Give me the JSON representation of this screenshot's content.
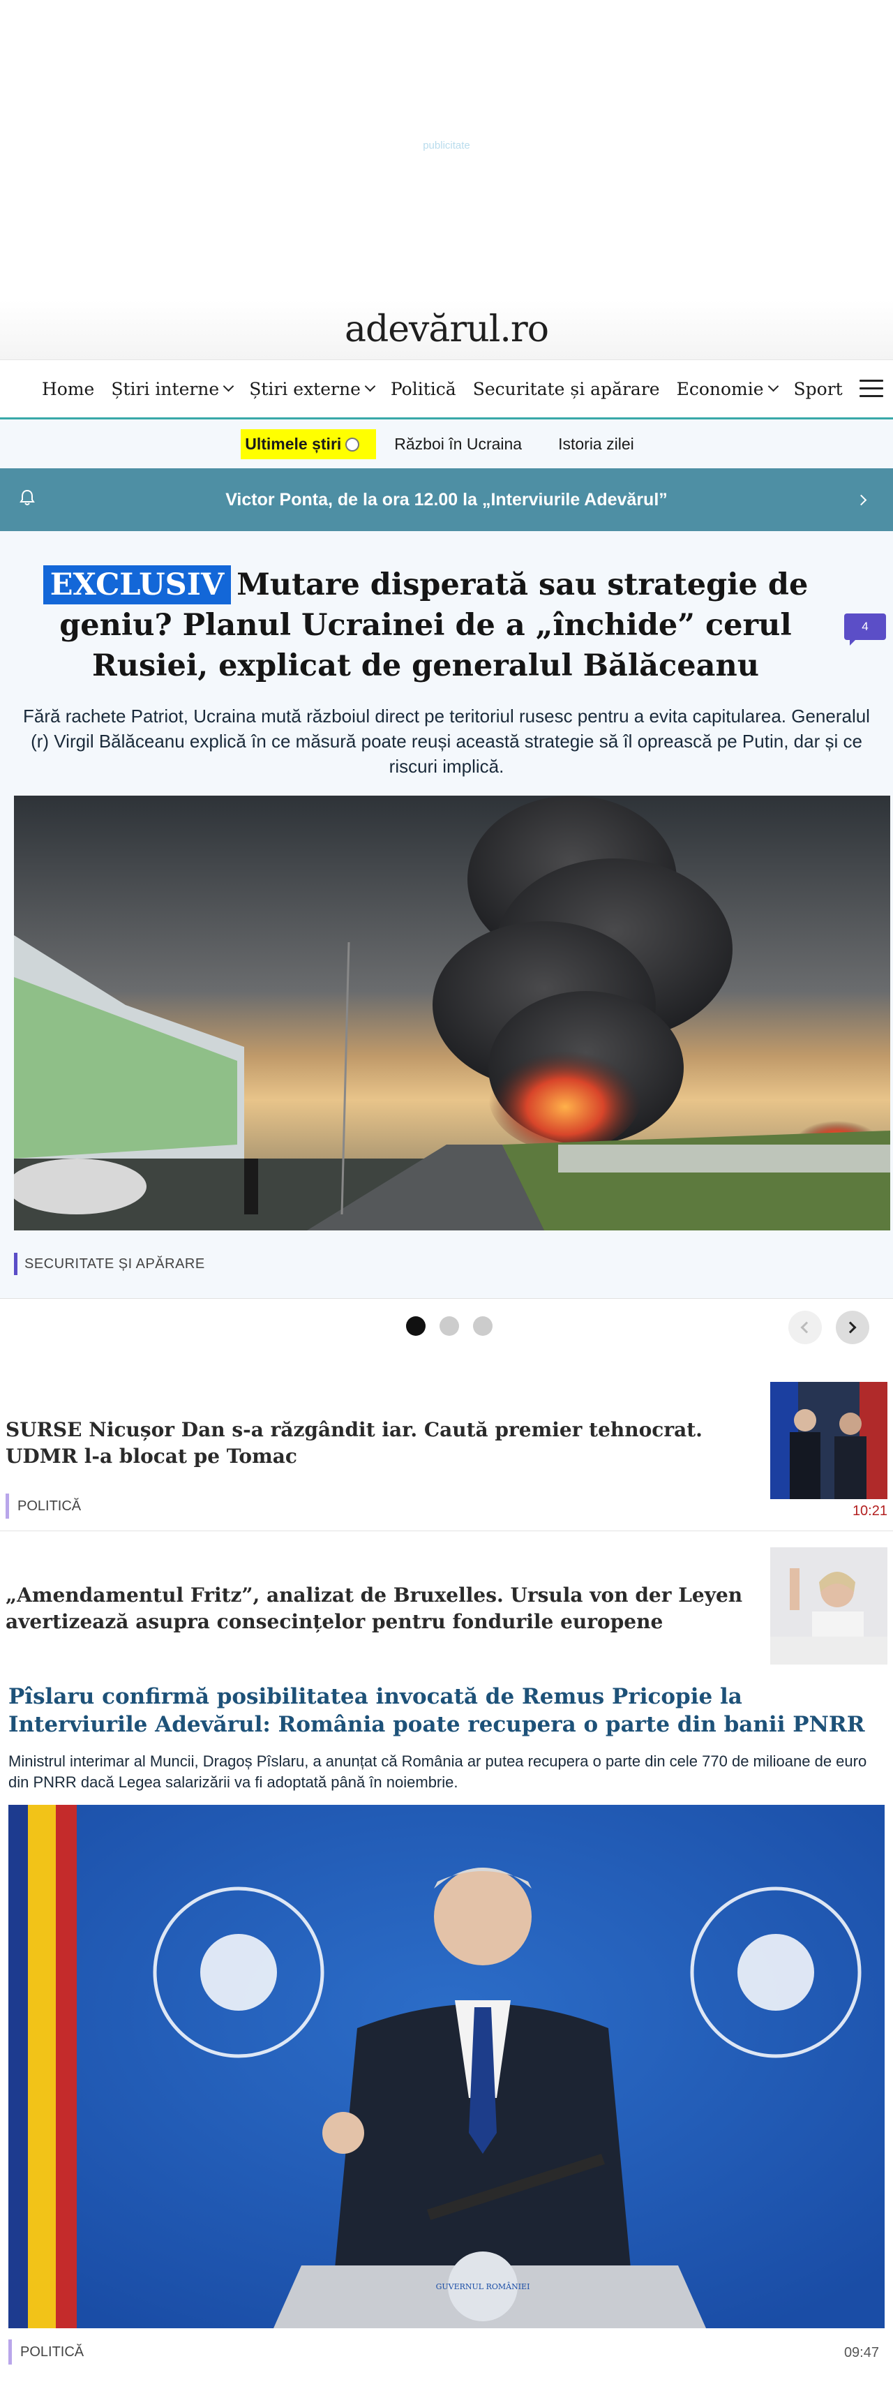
{
  "ad": {
    "label": "publicitate"
  },
  "site": {
    "logo": "adevărul.ro"
  },
  "nav": {
    "items": [
      {
        "label": "Home",
        "dropdown": false
      },
      {
        "label": "Știri interne",
        "dropdown": true
      },
      {
        "label": "Știri externe",
        "dropdown": true
      },
      {
        "label": "Politică",
        "dropdown": false
      },
      {
        "label": "Securitate și apărare",
        "dropdown": false
      },
      {
        "label": "Economie",
        "dropdown": true
      },
      {
        "label": "Sport",
        "dropdown": false
      }
    ]
  },
  "subnav": {
    "latest": "Ultimele știri",
    "items": [
      "Război în Ucraina",
      "Istoria zilei"
    ]
  },
  "banner": {
    "text": "Victor Ponta, de la ora 12.00 la „Interviurile Adevărul”"
  },
  "hero": {
    "badge": "EXCLUSIV",
    "title": "Mutare disperată sau strategie de geniu? Planul Ucrainei de a „închide” cerul Rusiei, explicat de generalul Bălăceanu",
    "comments": "4",
    "lead": "Fără rachete Patriot, Ucraina mută războiul direct pe teritoriul rusesc pentru a evita capitularea. Generalul (r) Virgil Bălăceanu explică în ce măsură poate reuși această strategie să îl oprească pe Putin, dar și ce riscuri implică.",
    "category": "SECURITATE ȘI APĂRARE"
  },
  "carousel": {
    "active_index": 0,
    "count": 3
  },
  "news": [
    {
      "title": "SURSE Nicușor Dan s-a răzgândit iar. Caută premier tehnocrat. UDMR l-a blocat pe Tomac",
      "category": "POLITICĂ",
      "time": "10:21"
    },
    {
      "title": "„Amendamentul Fritz”, analizat de Bruxelles. Ursula von der Leyen avertizează asupra consecințelor pentru fondurile europene"
    }
  ],
  "featured": {
    "title": "Pîslaru confirmă posibilitatea invocată de Remus Pricopie la Interviurile Adevărul: România poate recupera o parte din banii PNRR",
    "lead": "Ministrul interimar al Muncii, Dragoș Pîslaru, a anunțat că România ar putea recupera o parte din cele 770 de milioane de euro din PNRR dacă Legea salarizării va fi adoptată până în noiembrie.",
    "category": "POLITICĂ",
    "time": "09:47",
    "seal_text": "GUVERNUL ROMÂNIEI"
  },
  "colors": {
    "accent": "#38a8a8",
    "badge": "#1367d8",
    "banner": "#4e8fa4",
    "category_bar": "#5b4ec7",
    "featured_title": "#1d5178",
    "time_red": "#b32020"
  }
}
